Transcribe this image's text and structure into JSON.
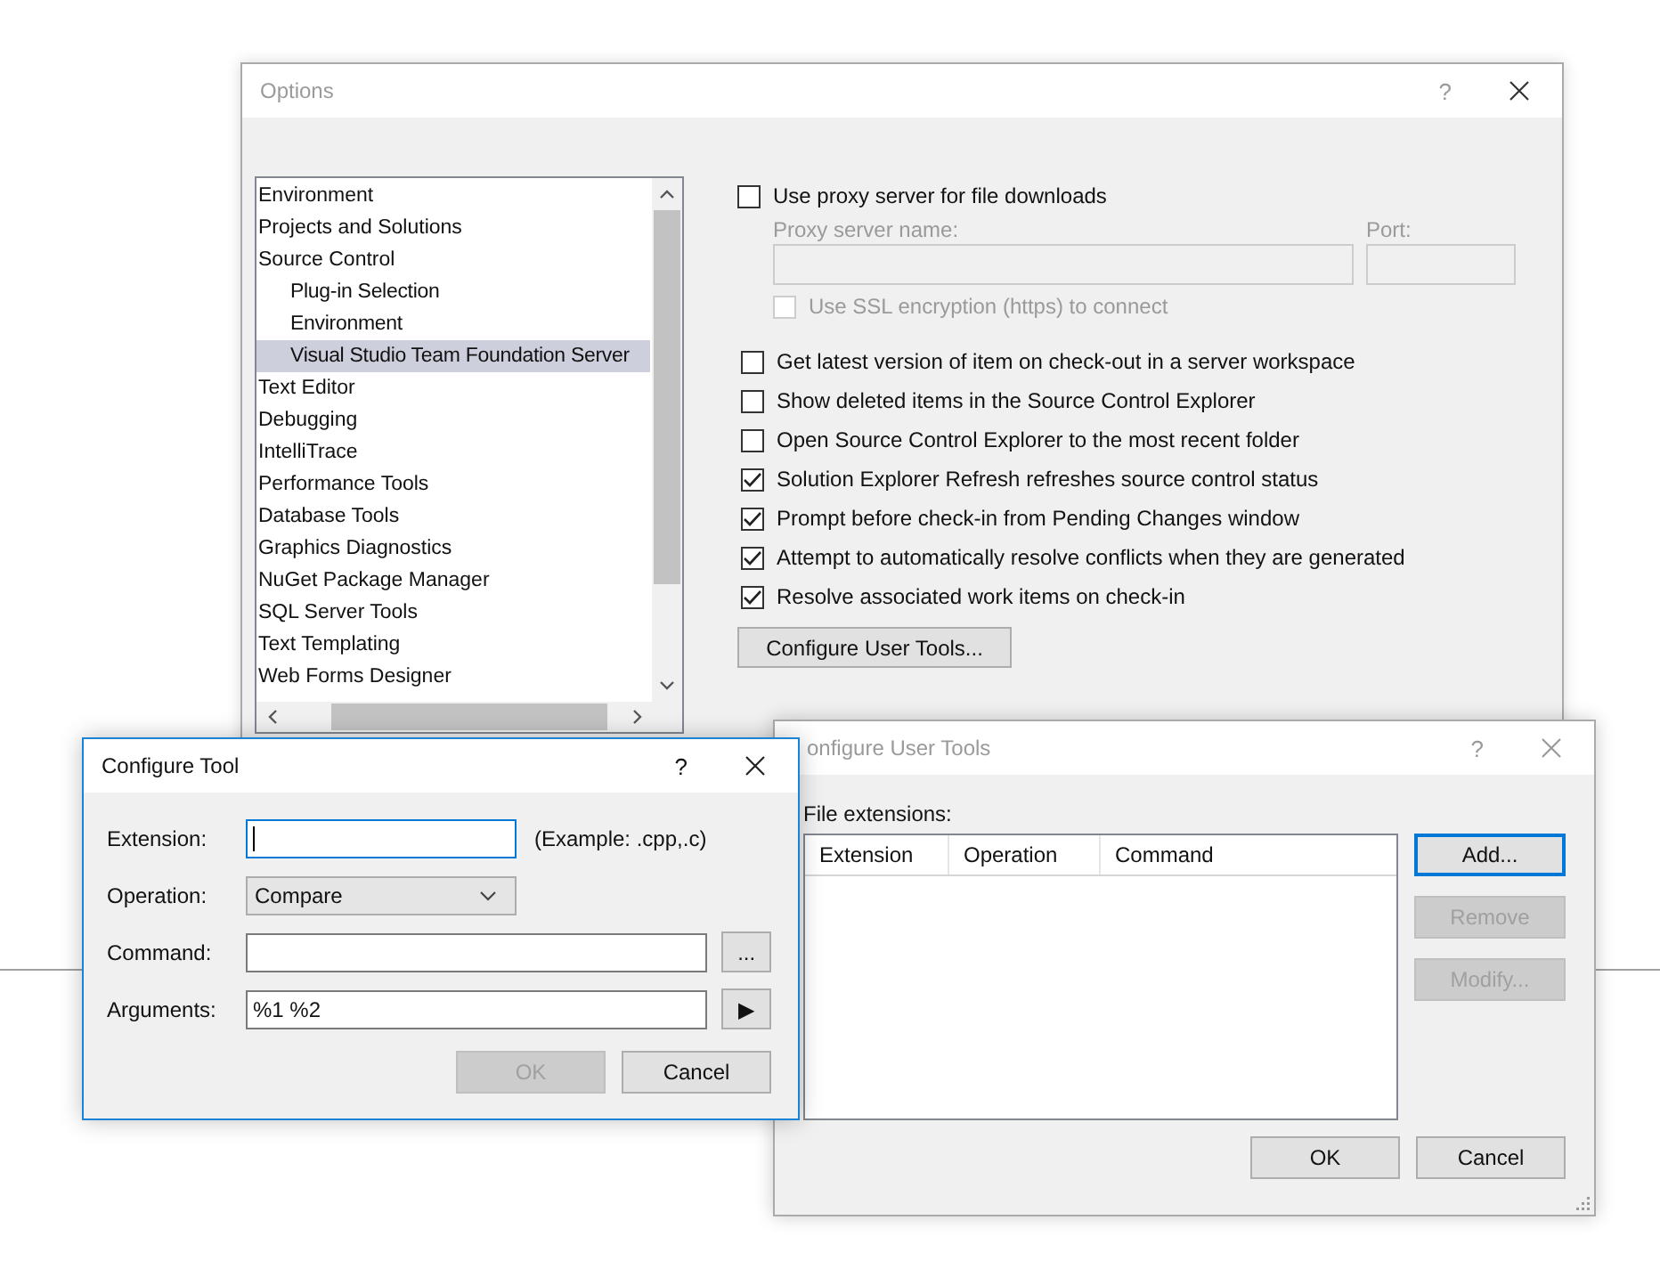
{
  "options_window": {
    "title": "Options",
    "help": "?",
    "tree": [
      {
        "label": "Environment",
        "selected": false
      },
      {
        "label": "Projects and Solutions",
        "selected": false
      },
      {
        "label": "Source Control",
        "selected": false,
        "children": [
          {
            "label": "Plug-in Selection",
            "selected": false
          },
          {
            "label": "Environment",
            "selected": false
          },
          {
            "label": "Visual Studio Team Foundation Server",
            "selected": true
          }
        ]
      },
      {
        "label": "Text Editor",
        "selected": false
      },
      {
        "label": "Debugging",
        "selected": false
      },
      {
        "label": "IntelliTrace",
        "selected": false
      },
      {
        "label": "Performance Tools",
        "selected": false
      },
      {
        "label": "Database Tools",
        "selected": false
      },
      {
        "label": "Graphics Diagnostics",
        "selected": false
      },
      {
        "label": "NuGet Package Manager",
        "selected": false
      },
      {
        "label": "SQL Server Tools",
        "selected": false
      },
      {
        "label": "Text Templating",
        "selected": false
      },
      {
        "label": "Web Forms Designer",
        "selected": false
      }
    ],
    "proxy": {
      "label": "Use proxy server for file downloads",
      "checked": false,
      "server_label": "Proxy server name:",
      "port_label": "Port:",
      "ssl_label": "Use SSL encryption (https) to connect",
      "ssl_checked": false
    },
    "settings": [
      {
        "label": "Get latest version of item on check-out in a server workspace",
        "checked": false
      },
      {
        "label": "Show deleted items in the Source Control Explorer",
        "checked": false
      },
      {
        "label": "Open Source Control Explorer to the most recent folder",
        "checked": false
      },
      {
        "label": "Solution Explorer Refresh refreshes source control status",
        "checked": true
      },
      {
        "label": "Prompt before check-in from Pending Changes window",
        "checked": true
      },
      {
        "label": "Attempt to automatically resolve conflicts when they are generated",
        "checked": true
      },
      {
        "label": "Resolve associated work items on check-in",
        "checked": true
      }
    ],
    "configure_button": "Configure User Tools..."
  },
  "user_tools": {
    "title": "onfigure User Tools",
    "help": "?",
    "list_label": "File extensions:",
    "columns": [
      "Extension",
      "Operation",
      "Command"
    ],
    "side_buttons": [
      {
        "label": "Add...",
        "disabled": false
      },
      {
        "label": "Remove",
        "disabled": true
      },
      {
        "label": "Modify...",
        "disabled": true
      }
    ],
    "footer_buttons": [
      {
        "label": "OK",
        "disabled": false
      },
      {
        "label": "Cancel",
        "disabled": false
      }
    ]
  },
  "configure_tool": {
    "title": "Configure Tool",
    "help": "?",
    "fields": [
      {
        "kind": "text",
        "label": "Extension:",
        "hint": "(Example: .cpp,.c)"
      },
      {
        "kind": "select",
        "label": "Operation:",
        "value": "Compare"
      },
      {
        "kind": "text",
        "label": "Command:",
        "action": "..."
      },
      {
        "kind": "text",
        "label": "Arguments:",
        "value": "%1 %2",
        "action": "▶"
      }
    ],
    "buttons": [
      {
        "label": "OK",
        "disabled": true
      },
      {
        "label": "Cancel",
        "disabled": false
      }
    ]
  }
}
